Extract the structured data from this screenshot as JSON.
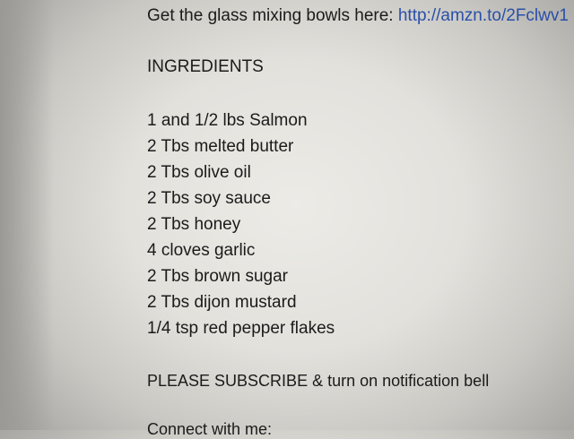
{
  "description": {
    "bowls_text": "Get the glass mixing bowls here: ",
    "bowls_link": "http://amzn.to/2Fclwv1",
    "ingredients_heading": "INGREDIENTS",
    "ingredients": [
      "1 and 1/2 lbs Salmon",
      "2 Tbs melted butter",
      "2 Tbs olive oil",
      "2 Tbs soy sauce",
      "2 Tbs honey",
      "4 cloves garlic",
      "2 Tbs brown sugar",
      "2 Tbs dijon mustard",
      "1/4 tsp red pepper flakes"
    ],
    "subscribe_text": "PLEASE SUBSCRIBE & turn on notification bell",
    "connect_text": "Connect with me:"
  }
}
